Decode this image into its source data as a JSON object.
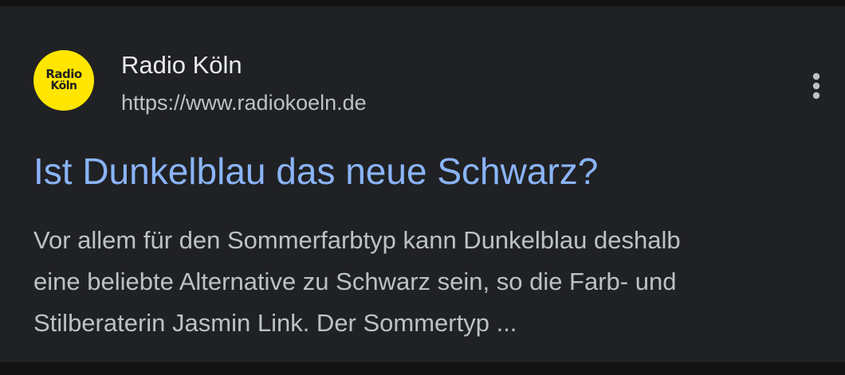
{
  "result": {
    "source": {
      "logo_line1": "Radio",
      "logo_line2": "Köln",
      "name": "Radio Köln",
      "url": "https://www.radiokoeln.de"
    },
    "title": "Ist Dunkelblau das neue Schwarz?",
    "snippet_lines": [
      "Vor allem für den Sommerfarbtyp kann Dunkelblau deshalb",
      "eine beliebte Alternative zu Schwarz sein, so die Farb- und",
      "Stilberaterin Jasmin Link. Der Sommertyp ..."
    ],
    "more_icon": "more-vert-icon"
  },
  "colors": {
    "page_background": "#131313",
    "card_background": "#202124",
    "title_link": "#8ab4f8",
    "logo_yellow": "#ffe600",
    "primary_text": "#e8eaed",
    "secondary_text": "#bdc1c6"
  }
}
